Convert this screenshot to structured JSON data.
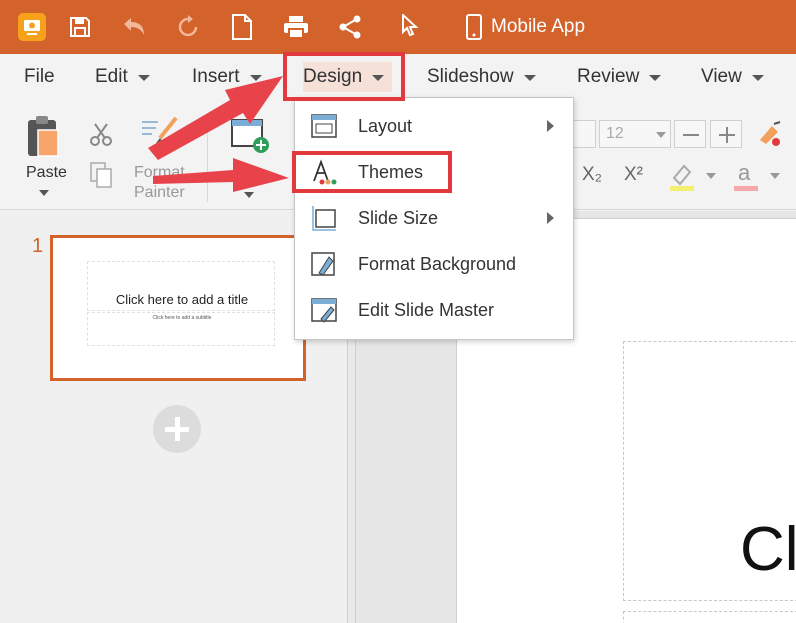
{
  "titlebar": {
    "app_title": "Mobile App",
    "icons": [
      "app-logo-icon",
      "save-icon",
      "undo-icon",
      "redo-icon",
      "new-file-icon",
      "print-icon",
      "share-icon",
      "pointer-icon",
      "mobile-device-icon"
    ]
  },
  "menubar": {
    "items": [
      {
        "label": "File"
      },
      {
        "label": "Edit"
      },
      {
        "label": "Insert"
      },
      {
        "label": "Design"
      },
      {
        "label": "Slideshow"
      },
      {
        "label": "Review"
      },
      {
        "label": "View"
      }
    ]
  },
  "ribbon": {
    "paste_label": "Paste",
    "format_painter_line1": "Format",
    "format_painter_line2": "Painter",
    "font_size_value": "12",
    "subscript_label": "X₂",
    "superscript_label": "X²",
    "font_color_glyph": "a"
  },
  "design_menu": {
    "items": [
      {
        "label": "Layout",
        "icon": "layout-icon",
        "submenu": true
      },
      {
        "label": "Themes",
        "icon": "themes-icon",
        "submenu": false
      },
      {
        "label": "Slide Size",
        "icon": "slide-size-icon",
        "submenu": true
      },
      {
        "label": "Format Background",
        "icon": "format-background-icon",
        "submenu": false
      },
      {
        "label": "Edit Slide Master",
        "icon": "edit-slide-master-icon",
        "submenu": false
      }
    ]
  },
  "slides_panel": {
    "slide_number": "1",
    "thumb_title": "Click here to add a title",
    "thumb_subtitle": "Click here to add a subtitle"
  },
  "canvas": {
    "visible_title_text": "Cl"
  },
  "colors": {
    "titlebar": "#d4622b",
    "highlight": "#e2393f",
    "accent": "#d4622b"
  }
}
